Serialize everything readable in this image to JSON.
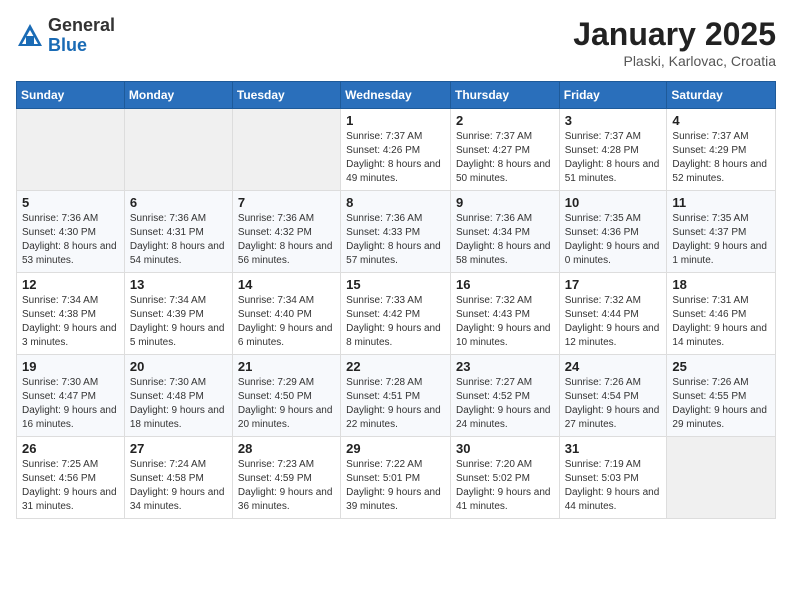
{
  "logo": {
    "general": "General",
    "blue": "Blue"
  },
  "header": {
    "month": "January 2025",
    "location": "Plaski, Karlovac, Croatia"
  },
  "weekdays": [
    "Sunday",
    "Monday",
    "Tuesday",
    "Wednesday",
    "Thursday",
    "Friday",
    "Saturday"
  ],
  "weeks": [
    [
      {
        "day": "",
        "sunrise": "",
        "sunset": "",
        "daylight": ""
      },
      {
        "day": "",
        "sunrise": "",
        "sunset": "",
        "daylight": ""
      },
      {
        "day": "",
        "sunrise": "",
        "sunset": "",
        "daylight": ""
      },
      {
        "day": "1",
        "sunrise": "Sunrise: 7:37 AM",
        "sunset": "Sunset: 4:26 PM",
        "daylight": "Daylight: 8 hours and 49 minutes."
      },
      {
        "day": "2",
        "sunrise": "Sunrise: 7:37 AM",
        "sunset": "Sunset: 4:27 PM",
        "daylight": "Daylight: 8 hours and 50 minutes."
      },
      {
        "day": "3",
        "sunrise": "Sunrise: 7:37 AM",
        "sunset": "Sunset: 4:28 PM",
        "daylight": "Daylight: 8 hours and 51 minutes."
      },
      {
        "day": "4",
        "sunrise": "Sunrise: 7:37 AM",
        "sunset": "Sunset: 4:29 PM",
        "daylight": "Daylight: 8 hours and 52 minutes."
      }
    ],
    [
      {
        "day": "5",
        "sunrise": "Sunrise: 7:36 AM",
        "sunset": "Sunset: 4:30 PM",
        "daylight": "Daylight: 8 hours and 53 minutes."
      },
      {
        "day": "6",
        "sunrise": "Sunrise: 7:36 AM",
        "sunset": "Sunset: 4:31 PM",
        "daylight": "Daylight: 8 hours and 54 minutes."
      },
      {
        "day": "7",
        "sunrise": "Sunrise: 7:36 AM",
        "sunset": "Sunset: 4:32 PM",
        "daylight": "Daylight: 8 hours and 56 minutes."
      },
      {
        "day": "8",
        "sunrise": "Sunrise: 7:36 AM",
        "sunset": "Sunset: 4:33 PM",
        "daylight": "Daylight: 8 hours and 57 minutes."
      },
      {
        "day": "9",
        "sunrise": "Sunrise: 7:36 AM",
        "sunset": "Sunset: 4:34 PM",
        "daylight": "Daylight: 8 hours and 58 minutes."
      },
      {
        "day": "10",
        "sunrise": "Sunrise: 7:35 AM",
        "sunset": "Sunset: 4:36 PM",
        "daylight": "Daylight: 9 hours and 0 minutes."
      },
      {
        "day": "11",
        "sunrise": "Sunrise: 7:35 AM",
        "sunset": "Sunset: 4:37 PM",
        "daylight": "Daylight: 9 hours and 1 minute."
      }
    ],
    [
      {
        "day": "12",
        "sunrise": "Sunrise: 7:34 AM",
        "sunset": "Sunset: 4:38 PM",
        "daylight": "Daylight: 9 hours and 3 minutes."
      },
      {
        "day": "13",
        "sunrise": "Sunrise: 7:34 AM",
        "sunset": "Sunset: 4:39 PM",
        "daylight": "Daylight: 9 hours and 5 minutes."
      },
      {
        "day": "14",
        "sunrise": "Sunrise: 7:34 AM",
        "sunset": "Sunset: 4:40 PM",
        "daylight": "Daylight: 9 hours and 6 minutes."
      },
      {
        "day": "15",
        "sunrise": "Sunrise: 7:33 AM",
        "sunset": "Sunset: 4:42 PM",
        "daylight": "Daylight: 9 hours and 8 minutes."
      },
      {
        "day": "16",
        "sunrise": "Sunrise: 7:32 AM",
        "sunset": "Sunset: 4:43 PM",
        "daylight": "Daylight: 9 hours and 10 minutes."
      },
      {
        "day": "17",
        "sunrise": "Sunrise: 7:32 AM",
        "sunset": "Sunset: 4:44 PM",
        "daylight": "Daylight: 9 hours and 12 minutes."
      },
      {
        "day": "18",
        "sunrise": "Sunrise: 7:31 AM",
        "sunset": "Sunset: 4:46 PM",
        "daylight": "Daylight: 9 hours and 14 minutes."
      }
    ],
    [
      {
        "day": "19",
        "sunrise": "Sunrise: 7:30 AM",
        "sunset": "Sunset: 4:47 PM",
        "daylight": "Daylight: 9 hours and 16 minutes."
      },
      {
        "day": "20",
        "sunrise": "Sunrise: 7:30 AM",
        "sunset": "Sunset: 4:48 PM",
        "daylight": "Daylight: 9 hours and 18 minutes."
      },
      {
        "day": "21",
        "sunrise": "Sunrise: 7:29 AM",
        "sunset": "Sunset: 4:50 PM",
        "daylight": "Daylight: 9 hours and 20 minutes."
      },
      {
        "day": "22",
        "sunrise": "Sunrise: 7:28 AM",
        "sunset": "Sunset: 4:51 PM",
        "daylight": "Daylight: 9 hours and 22 minutes."
      },
      {
        "day": "23",
        "sunrise": "Sunrise: 7:27 AM",
        "sunset": "Sunset: 4:52 PM",
        "daylight": "Daylight: 9 hours and 24 minutes."
      },
      {
        "day": "24",
        "sunrise": "Sunrise: 7:26 AM",
        "sunset": "Sunset: 4:54 PM",
        "daylight": "Daylight: 9 hours and 27 minutes."
      },
      {
        "day": "25",
        "sunrise": "Sunrise: 7:26 AM",
        "sunset": "Sunset: 4:55 PM",
        "daylight": "Daylight: 9 hours and 29 minutes."
      }
    ],
    [
      {
        "day": "26",
        "sunrise": "Sunrise: 7:25 AM",
        "sunset": "Sunset: 4:56 PM",
        "daylight": "Daylight: 9 hours and 31 minutes."
      },
      {
        "day": "27",
        "sunrise": "Sunrise: 7:24 AM",
        "sunset": "Sunset: 4:58 PM",
        "daylight": "Daylight: 9 hours and 34 minutes."
      },
      {
        "day": "28",
        "sunrise": "Sunrise: 7:23 AM",
        "sunset": "Sunset: 4:59 PM",
        "daylight": "Daylight: 9 hours and 36 minutes."
      },
      {
        "day": "29",
        "sunrise": "Sunrise: 7:22 AM",
        "sunset": "Sunset: 5:01 PM",
        "daylight": "Daylight: 9 hours and 39 minutes."
      },
      {
        "day": "30",
        "sunrise": "Sunrise: 7:20 AM",
        "sunset": "Sunset: 5:02 PM",
        "daylight": "Daylight: 9 hours and 41 minutes."
      },
      {
        "day": "31",
        "sunrise": "Sunrise: 7:19 AM",
        "sunset": "Sunset: 5:03 PM",
        "daylight": "Daylight: 9 hours and 44 minutes."
      },
      {
        "day": "",
        "sunrise": "",
        "sunset": "",
        "daylight": ""
      }
    ]
  ]
}
